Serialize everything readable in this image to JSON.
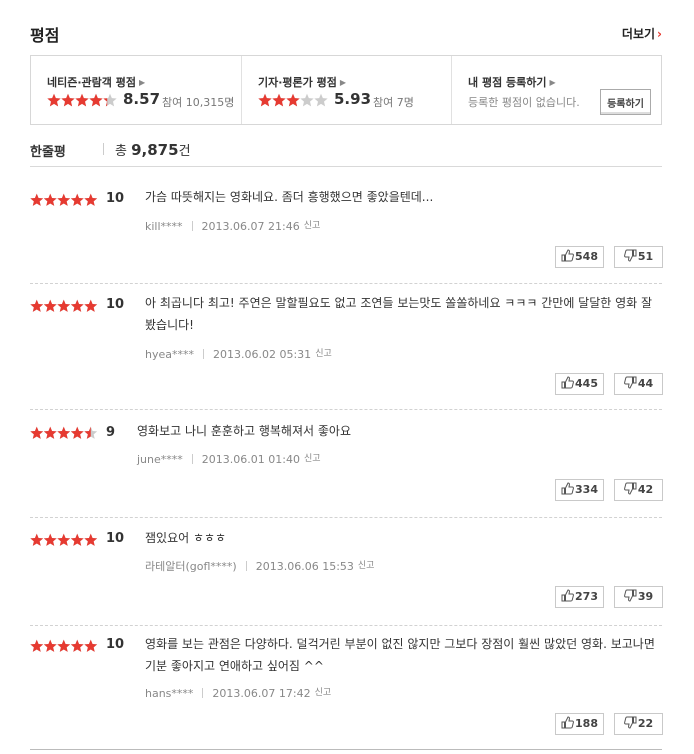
{
  "header": {
    "title": "평점",
    "more_label": "더보기",
    "more_chevron": "›"
  },
  "ratings": {
    "netizen": {
      "label": "네티즌·관람객 평점",
      "score": "8.57",
      "count_text": "참여 10,315명",
      "stars": 4.3
    },
    "critic": {
      "label": "기자·평론가 평점",
      "score": "5.93",
      "count_text": "참여 7명",
      "stars": 3.0
    },
    "mine": {
      "label": "내 평점 등록하기",
      "desc": "등록한 평점이 없습니다.",
      "button": "등록하기"
    }
  },
  "section": {
    "title": "한줄평",
    "total_prefix": "총",
    "total_count": "9,875",
    "total_suffix": "건"
  },
  "colors": {
    "star_on": "#e63a31",
    "star_off": "#cccccc",
    "accent": "#e63a31"
  },
  "reviews": [
    {
      "score": "10",
      "stars": 5,
      "text": "가슴 따뜻해지는 영화네요. 좀더 흥행했으면 좋았을텐데...",
      "user": "kill****",
      "date": "2013.06.07 21:46",
      "report": "신고",
      "up": "548",
      "down": "51"
    },
    {
      "score": "10",
      "stars": 5,
      "text": "아 최곱니다 최고! 주연은 말할필요도 없고 조연들 보는맛도 쏠쏠하네요 ㅋㅋㅋ 간만에 달달한 영화 잘봤습니다!",
      "user": "hyea****",
      "date": "2013.06.02 05:31",
      "report": "신고",
      "up": "445",
      "down": "44"
    },
    {
      "score": "9",
      "stars": 4.5,
      "text": "영화보고 나니 훈훈하고 행복해져서 좋아요",
      "user": "june****",
      "date": "2013.06.01 01:40",
      "report": "신고",
      "up": "334",
      "down": "42"
    },
    {
      "score": "10",
      "stars": 5,
      "text": "잼있요어 ㅎㅎㅎ",
      "user": "라테알터(gofl****)",
      "date": "2013.06.06 15:53",
      "report": "신고",
      "up": "273",
      "down": "39"
    },
    {
      "score": "10",
      "stars": 5,
      "text": "영화를 보는 관점은 다양하다. 덜걱거린 부분이 없진 않지만 그보다 장점이 훨씬 많았던 영화. 보고나면 기분 좋아지고 연애하고 싶어짐 ^^",
      "user": "hans****",
      "date": "2013.06.07 17:42",
      "report": "신고",
      "up": "188",
      "down": "22"
    }
  ]
}
